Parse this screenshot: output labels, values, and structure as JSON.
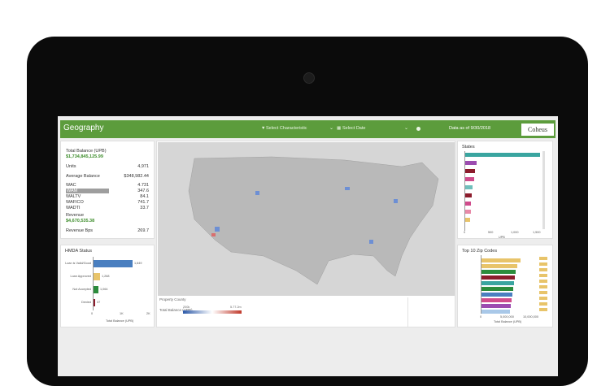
{
  "app": {
    "title": "Geography",
    "select_characteristic": "Select Characteristic",
    "select_date": "Select Date",
    "data_as_of": "Data as of 9/30/2018",
    "logo_text": "Coheus"
  },
  "kpis": {
    "total_balance_label": "Total Balance (UPB)",
    "total_balance_value": "$1,734,845,125.99",
    "units_label": "Units",
    "units_value": "4,971",
    "avg_balance_label": "Average Balance",
    "avg_balance_value": "$348,982.44",
    "wac_label": "WAC",
    "wac_value": "4.731",
    "wam_label": "WAM",
    "wam_value": "347.6",
    "waltv_label": "WALTV",
    "waltv_value": "84.1",
    "wafico_label": "WAFICO",
    "wafico_value": "741.7",
    "wadti_label": "WADTI",
    "wadti_value": "33.7",
    "revenue_label": "Revenue",
    "revenue_value": "$4,670,535.38",
    "revenue_bps_label": "Revenue Bps",
    "revenue_bps_value": "269.7"
  },
  "hmda": {
    "title": "HMDA Status",
    "rows": [
      "Loan is Valid/Good",
      "Loan Approved",
      "Not Accepted",
      "Denied"
    ],
    "values": [
      "1,649",
      "1,268",
      "1,064",
      "37"
    ],
    "axis_ticks": [
      "0",
      "1K",
      "2K"
    ],
    "footer": "Total Balance (UPB)"
  },
  "map": {
    "footer_label": "Property County",
    "legend_label": "Total Balance (UPB)",
    "legend_min": "200k",
    "legend_max": "5.77.2m"
  },
  "states": {
    "title": "States",
    "axis_ticks": [
      "0",
      "500",
      "1,000",
      "1,500"
    ],
    "footer": "UPB"
  },
  "zips": {
    "title": "Top 10 Zip Codes",
    "axis_ticks": [
      "0",
      "5,000,000",
      "10,000,000"
    ],
    "footer": "Total Balance (UPB)"
  },
  "colors": {
    "header_green": "#5c9c3c",
    "kpi_green": "#3c8c2a",
    "bar_blue": "#4a7fc0",
    "bar_yellow": "#e8c46a",
    "bar_teal": "#3aa5a0",
    "bar_maroon": "#8c1c2c",
    "bar_green": "#2c8c3c",
    "bar_pink": "#d04c8c",
    "bar_purple": "#9c4cb0"
  }
}
